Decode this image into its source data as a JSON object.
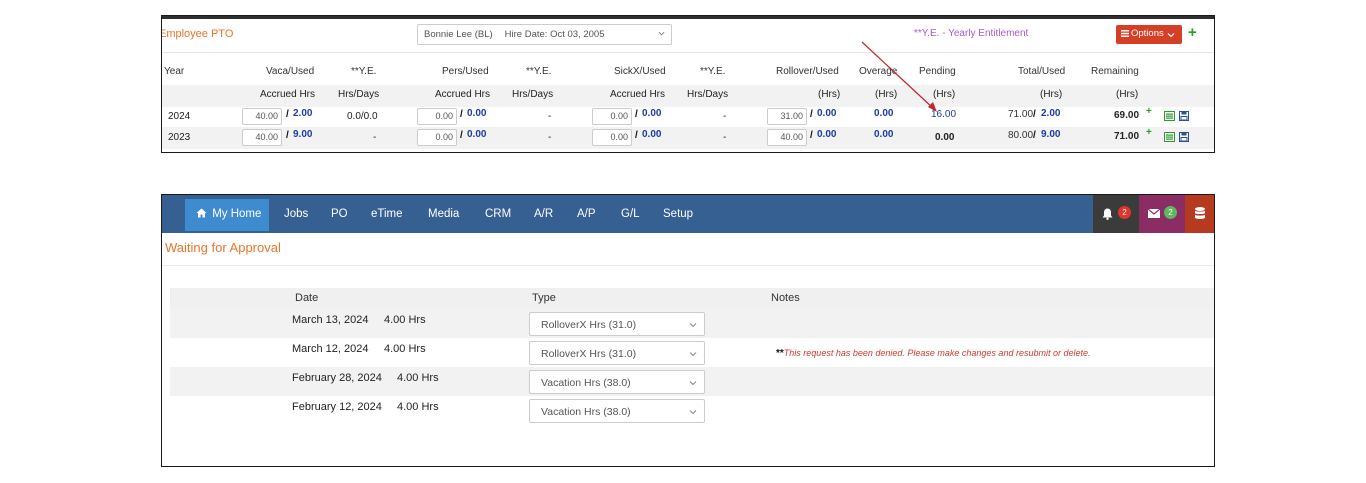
{
  "pto": {
    "title": "Employee  PTO",
    "employee_select": {
      "name": "Bonnie Lee (BL)",
      "hire_date": "Hire Date: Oct 03, 2005"
    },
    "ye_link": "**Y.E. - Yearly Entitlement",
    "options_label": "Options",
    "headers_top": [
      "Year",
      "Vaca/Used",
      "**Y.E.",
      "Pers/Used",
      "**Y.E.",
      "SickX/Used",
      "**Y.E.",
      "Rollover/Used",
      "Overage",
      "Pending",
      "Total/Used",
      "Remaining"
    ],
    "headers_sub": [
      "Accrued Hrs",
      "Hrs/Days",
      "Accrued Hrs",
      "Hrs/Days",
      "Accrued Hrs",
      "Hrs/Days",
      "(Hrs)",
      "(Hrs)",
      "(Hrs)",
      "(Hrs)",
      "(Hrs)"
    ],
    "rows": [
      {
        "year": "2024",
        "vaca": "40.00",
        "vaca_used": "2.00",
        "ye1": "0.0/0.0",
        "pers": "0.00",
        "pers_used": "0.00",
        "ye2": "-",
        "sick": "0.00",
        "sick_used": "0.00",
        "ye3": "-",
        "roll": "31.00",
        "roll_used": "0.00",
        "overage": "0.00",
        "pending": "16.00",
        "total": "71.00",
        "total_used": "2.00",
        "remaining": "69.00"
      },
      {
        "year": "2023",
        "vaca": "40.00",
        "vaca_used": "9.00",
        "ye1": "-",
        "pers": "0.00",
        "pers_used": "0.00",
        "ye2": "-",
        "sick": "0.00",
        "sick_used": "0.00",
        "ye3": "-",
        "roll": "40.00",
        "roll_used": "0.00",
        "overage": "0.00",
        "pending": "0.00",
        "total": "80.00",
        "total_used": "9.00",
        "remaining": "71.00"
      }
    ],
    "colors": {
      "accent": "#e8742a",
      "options_bg": "#d43f26",
      "ye_link": "#a45bd0",
      "used_value": "#1e3aa8",
      "annotation_arrow": "#c0282a"
    }
  },
  "approval": {
    "nav": {
      "items": [
        "My Home",
        "Jobs",
        "PO",
        "eTime",
        "Media",
        "CRM",
        "A/R",
        "A/P",
        "G/L",
        "Setup"
      ],
      "active": "My Home",
      "bell_count": "2",
      "mail_count": "2"
    },
    "title": "Waiting for Approval",
    "headers": {
      "date": "Date",
      "type": "Type",
      "notes": "Notes"
    },
    "rows": [
      {
        "date": "March 13, 2024",
        "hours": "4.00 Hrs",
        "type": "RolloverX Hrs (31.0)",
        "note": ""
      },
      {
        "date": "March 12, 2024",
        "hours": "4.00 Hrs",
        "type": "RolloverX Hrs (31.0)",
        "note_prefix": "**",
        "note": "This request has been denied. Please make changes and resubmit or delete."
      },
      {
        "date": "February 28, 2024",
        "hours": "4.00 Hrs",
        "type": "Vacation Hrs (38.0)",
        "note": ""
      },
      {
        "date": "February 12, 2024",
        "hours": "4.00 Hrs",
        "type": "Vacation Hrs (38.0)",
        "note": ""
      }
    ],
    "colors": {
      "nav_bg": "#365f92",
      "home_bg": "#3f8bd0",
      "bell_bg": "#3b3b3b",
      "mail_bg": "#8c2c64",
      "db_bg": "#b53a20",
      "badge_red": "#e0352b",
      "badge_green": "#5cb85c",
      "note": "#d23a2a"
    }
  }
}
